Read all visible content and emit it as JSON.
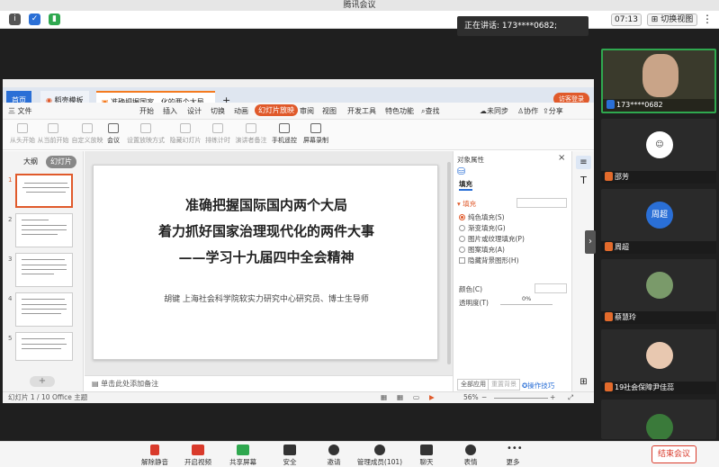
{
  "app": {
    "title": "腾讯会议"
  },
  "infobar": {
    "speaking": "正在讲话: 173****0682;",
    "timer": "07:13",
    "switch_view": "切换视图"
  },
  "wps": {
    "tabs": {
      "home": "首页",
      "template": "稻壳模板",
      "doc": "准确把握国家...化的两个大局",
      "new": "+",
      "login": "访客登录"
    },
    "menu": {
      "file": "三 文件",
      "items": [
        "开始",
        "插入",
        "设计",
        "切换",
        "动画",
        "幻灯片放映",
        "审阅",
        "视图",
        "开发工具",
        "特色功能"
      ],
      "search": "查找",
      "unsynced": "未同步",
      "collab": "协作",
      "share": "分享"
    },
    "toolbar": [
      "从头开始",
      "从当前开始",
      "自定义放映",
      "会议",
      "设置放映方式",
      "隐藏幻灯片",
      "排练计时",
      "演讲者备注",
      "手机遥控",
      "屏幕录制"
    ],
    "sidebar": {
      "outline": "大纲",
      "slides": "幻灯片",
      "nums": [
        "1",
        "2",
        "3",
        "4",
        "5"
      ]
    },
    "slide": {
      "line1": "准确把握国际国内两个大局",
      "line2": "着力抓好国家治理现代化的两件大事",
      "line3": "——学习十九届四中全会精神",
      "subtitle": "胡键  上海社会科学院软实力研究中心研究员、博士生导师"
    },
    "notes": "单击此处添加备注",
    "props": {
      "title": "对象属性",
      "fill_tab": "填充",
      "fill_label": "填充",
      "options": [
        "纯色填充(S)",
        "渐变填充(G)",
        "图片或纹理填充(P)",
        "图案填充(A)"
      ],
      "hide_bg": "隐藏背景图形(H)",
      "color_label": "颜色(C)",
      "transparency_label": "透明度(T)",
      "transparency_value": "0%",
      "apply_all": "全部应用",
      "reset_bg": "重置背景",
      "tips": "操作技巧"
    },
    "status": {
      "slide_pos": "幻灯片 1 / 10",
      "theme": "Office 主题",
      "zoom": "56%"
    }
  },
  "participants": [
    {
      "name": "173****0682"
    },
    {
      "name": "邵芳"
    },
    {
      "name": "周超",
      "avatar_text": "周超"
    },
    {
      "name": "蔡慧玲"
    },
    {
      "name": "19社会保障尹佳蕊"
    }
  ],
  "bottombar": {
    "unmute": "解除静音",
    "video": "开启视频",
    "share": "共享屏幕",
    "security": "安全",
    "invite": "邀请",
    "members": "管理成员(101)",
    "chat": "聊天",
    "reaction": "表情",
    "more": "更多",
    "end": "结束会议"
  },
  "colors": {
    "accent": "#e05a2b",
    "tab_orange": "#f47b20",
    "end_red": "#d93a2b"
  }
}
